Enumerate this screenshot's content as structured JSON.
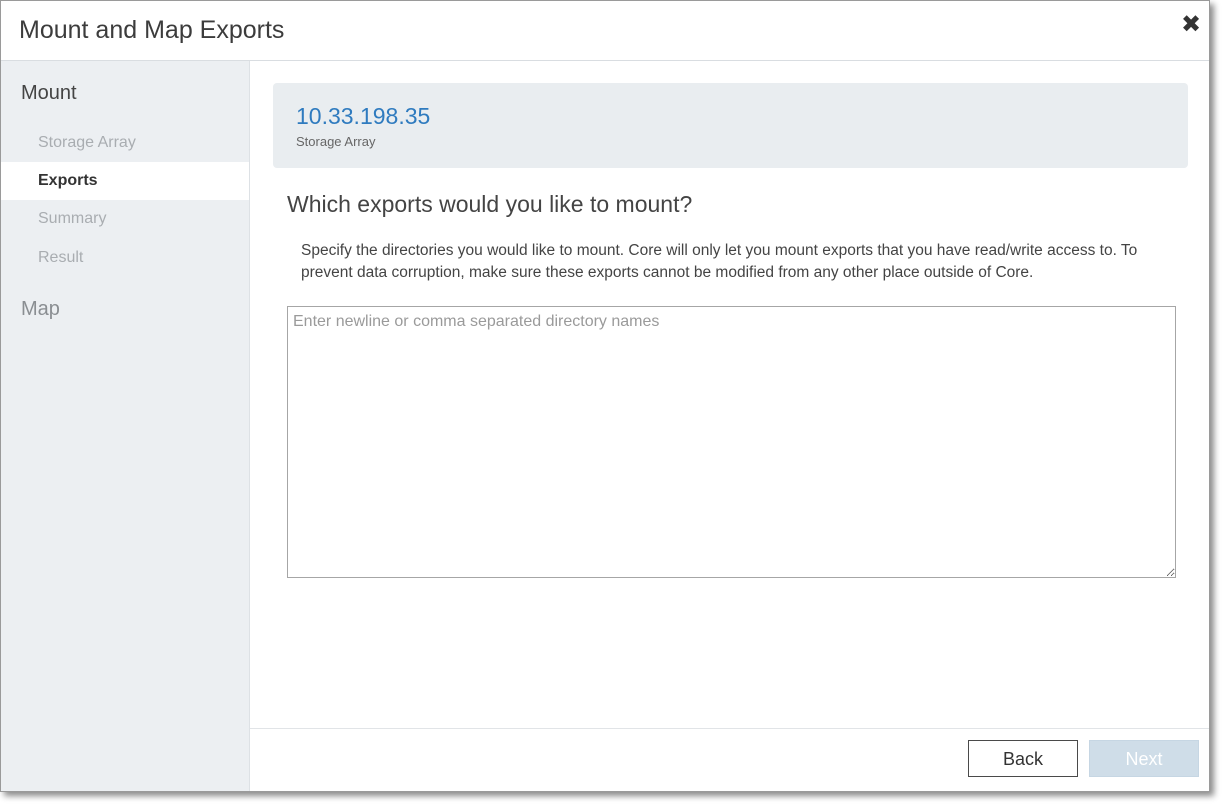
{
  "dialog": {
    "title": "Mount and Map Exports",
    "close_icon": "close-icon"
  },
  "sidebar": {
    "mount_heading": "Mount",
    "items": [
      {
        "label": "Storage Array",
        "state": "disabled"
      },
      {
        "label": "Exports",
        "state": "active"
      },
      {
        "label": "Summary",
        "state": "disabled"
      },
      {
        "label": "Result",
        "state": "disabled"
      }
    ],
    "map_heading": "Map"
  },
  "info": {
    "ip": "10.33.198.35",
    "label": "Storage Array"
  },
  "main": {
    "question": "Which exports would you like to mount?",
    "description": "Specify the directories you would like to mount. Core will only let you mount exports that you have read/write access to. To prevent data corruption, make sure these exports cannot be modified from any other place outside of Core.",
    "input": {
      "value": "",
      "placeholder": "Enter newline or comma separated directory names"
    }
  },
  "footer": {
    "back_label": "Back",
    "next_label": "Next"
  },
  "colors": {
    "accent": "#2f7bbf",
    "sidebar_bg": "#eceff2",
    "next_disabled_bg": "#cfdde8"
  }
}
